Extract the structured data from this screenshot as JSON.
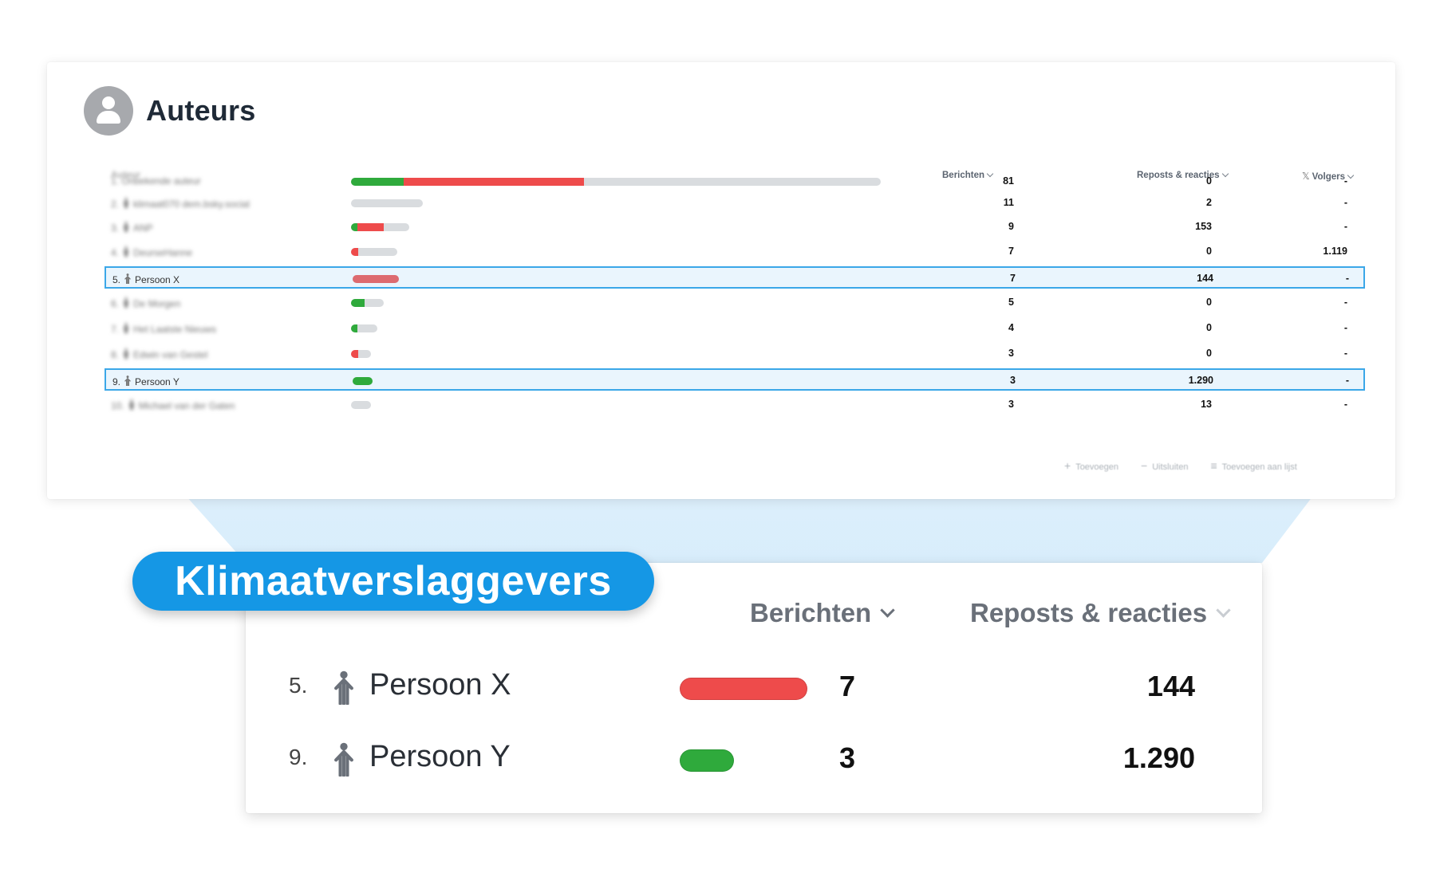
{
  "card": {
    "title": "Auteurs",
    "columns": {
      "auteur": "Auteur",
      "berichten": "Berichten",
      "reposts": "Reposts & reacties",
      "volgers": "Volgers"
    },
    "rows": [
      {
        "rank": "1.",
        "name": "Onbekende auteur",
        "green": 0.1,
        "red": 0.34,
        "track": 1.0,
        "berichten": "81",
        "reposts": "0",
        "volgers": "-",
        "highlight": false,
        "icon": false
      },
      {
        "rank": "2.",
        "name": "klimaat070 dem.bsky.social",
        "green": 0,
        "red": 0,
        "track": 0.136,
        "berichten": "11",
        "reposts": "2",
        "volgers": "-",
        "highlight": false,
        "icon": true
      },
      {
        "rank": "3.",
        "name": "ANP",
        "green": 0.012,
        "red": 0.05,
        "track": 0.11,
        "berichten": "9",
        "reposts": "153",
        "volgers": "-",
        "highlight": false,
        "icon": true
      },
      {
        "rank": "4.",
        "name": "DeurseHanne",
        "green": 0,
        "red": 0.014,
        "track": 0.087,
        "berichten": "7",
        "reposts": "0",
        "volgers": "1.119",
        "highlight": false,
        "icon": true
      },
      {
        "rank": "5.",
        "name": "Persoon X",
        "green": 0,
        "red": 0.087,
        "track": 0.087,
        "berichten": "7",
        "reposts": "144",
        "volgers": "-",
        "highlight": true,
        "icon": true
      },
      {
        "rank": "6.",
        "name": "De Morgen",
        "green": 0.025,
        "red": 0,
        "track": 0.062,
        "berichten": "5",
        "reposts": "0",
        "volgers": "-",
        "highlight": false,
        "icon": true
      },
      {
        "rank": "7.",
        "name": "Het Laatste Nieuws",
        "green": 0.012,
        "red": 0,
        "track": 0.05,
        "berichten": "4",
        "reposts": "0",
        "volgers": "-",
        "highlight": false,
        "icon": true
      },
      {
        "rank": "8.",
        "name": "Edwin van Gestel",
        "green": 0,
        "red": 0.014,
        "track": 0.037,
        "berichten": "3",
        "reposts": "0",
        "volgers": "-",
        "highlight": false,
        "icon": true
      },
      {
        "rank": "9.",
        "name": "Persoon Y",
        "green": 0.037,
        "red": 0,
        "track": 0.037,
        "berichten": "3",
        "reposts": "1.290",
        "volgers": "-",
        "highlight": true,
        "icon": true
      },
      {
        "rank": "10.",
        "name": "Michael van der Gaten",
        "green": 0,
        "red": 0,
        "track": 0.037,
        "berichten": "3",
        "reposts": "13",
        "volgers": "-",
        "highlight": false,
        "icon": true
      }
    ],
    "actions": {
      "add": "Toevoegen",
      "exclude": "Uitsluiten",
      "add_to_list": "Toevoegen aan lijst"
    }
  },
  "badge": "Klimaatverslaggevers",
  "zoom": {
    "col_berichten": "Berichten",
    "col_reposts": "Reposts & reacties",
    "rows": [
      {
        "rank": "5.",
        "name": "Persoon X",
        "berichten": "7",
        "reposts": "144",
        "color": "#ee4b4b"
      },
      {
        "rank": "9.",
        "name": "Persoon Y",
        "berichten": "3",
        "reposts": "1.290",
        "color": "#2faa3c"
      }
    ]
  },
  "colors": {
    "accent": "#1597e5",
    "highlight_border": "#3ba7e8",
    "bar_green": "#2faa3c",
    "bar_red": "#ee4b4b",
    "bar_track": "#d9dcdf"
  }
}
